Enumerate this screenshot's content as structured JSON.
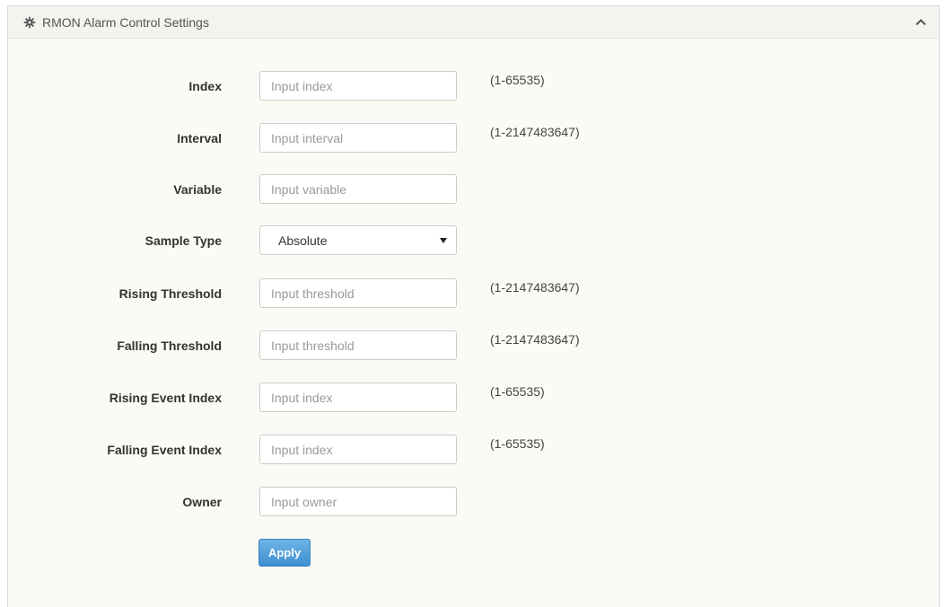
{
  "panel": {
    "title": "RMON Alarm Control Settings",
    "header_icon": "gear-icon",
    "collapse_icon": "chevron-up-icon"
  },
  "form": {
    "index": {
      "label": "Index",
      "placeholder": "Input index",
      "value": "",
      "range": "(1-65535)"
    },
    "interval": {
      "label": "Interval",
      "placeholder": "Input interval",
      "value": "",
      "range": "(1-2147483647)"
    },
    "variable": {
      "label": "Variable",
      "placeholder": "Input variable",
      "value": ""
    },
    "sample_type": {
      "label": "Sample Type",
      "selected": "Absolute"
    },
    "rising_threshold": {
      "label": "Rising Threshold",
      "placeholder": "Input threshold",
      "value": "",
      "range": "(1-2147483647)"
    },
    "falling_threshold": {
      "label": "Falling Threshold",
      "placeholder": "Input threshold",
      "value": "",
      "range": "(1-2147483647)"
    },
    "rising_event_index": {
      "label": "Rising Event Index",
      "placeholder": "Input index",
      "value": "",
      "range": "(1-65535)"
    },
    "falling_event_index": {
      "label": "Falling Event Index",
      "placeholder": "Input index",
      "value": "",
      "range": "(1-65535)"
    },
    "owner": {
      "label": "Owner",
      "placeholder": "Input owner",
      "value": ""
    },
    "apply_label": "Apply"
  },
  "colors": {
    "panel_bg": "#fbfbf5",
    "header_bg": "#f3f3ef",
    "button_blue": "#4a98d6"
  }
}
